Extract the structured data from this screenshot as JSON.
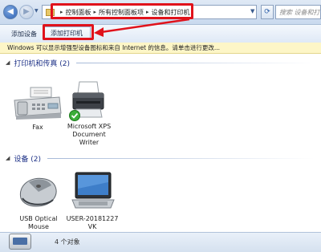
{
  "address_bar": {
    "breadcrumbs": [
      "控制面板",
      "所有控制面板项",
      "设备和打印机"
    ],
    "search_placeholder": "搜索 设备和打印机"
  },
  "toolbar": {
    "add_device_label": "添加设备",
    "add_printer_label": "添加打印机"
  },
  "info_bar": {
    "text": "Windows 可以显示增强型设备图标和来自 Internet 的信息。请单击进行更改..."
  },
  "sections": {
    "printers": {
      "title": "打印机和传真 (2)",
      "items": [
        {
          "label_lines": [
            "Fax"
          ]
        },
        {
          "label_lines": [
            "Microsoft XPS",
            "Document",
            "Writer"
          ]
        }
      ]
    },
    "devices": {
      "title": "设备 (2)",
      "items": [
        {
          "label_lines": [
            "USB Optical",
            "Mouse"
          ]
        },
        {
          "label_lines": [
            "USER-20181227",
            "VK"
          ]
        }
      ]
    }
  },
  "status_bar": {
    "count_text": "4 个对象"
  },
  "colors": {
    "highlight_red": "#e0121b",
    "section_title": "#1e3287",
    "info_bar_bg": "#fdf6c7"
  },
  "icons": [
    "back-arrow-icon",
    "forward-arrow-icon",
    "folder-icon",
    "refresh-icon",
    "fax-icon",
    "printer-icon",
    "default-check-icon",
    "mouse-icon",
    "computer-icon"
  ]
}
